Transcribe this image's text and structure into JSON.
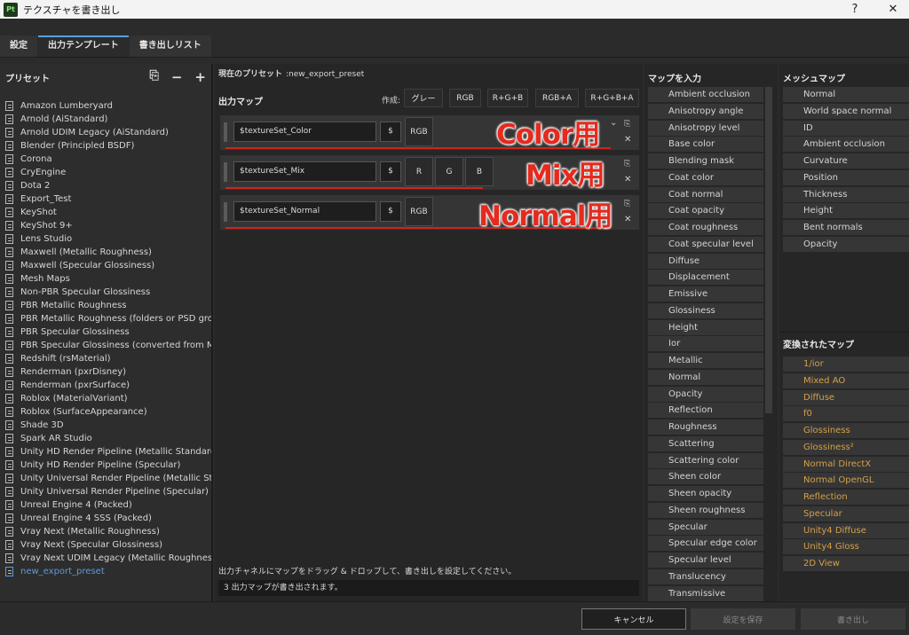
{
  "window": {
    "logo": "Pt",
    "title": "テクスチャを書き出し",
    "help": "?",
    "close": "✕"
  },
  "tabs": [
    "設定",
    "出力テンプレート",
    "書き出しリスト"
  ],
  "presets": {
    "title": "プリセット",
    "items": [
      "Amazon Lumberyard",
      "Arnold (AiStandard)",
      "Arnold UDIM Legacy (AiStandard)",
      "Blender (Principled BSDF)",
      "Corona",
      "CryEngine",
      "Dota 2",
      "Export_Test",
      "KeyShot",
      "KeyShot 9+",
      "Lens Studio",
      "Maxwell (Metallic Roughness)",
      "Maxwell (Specular Glossiness)",
      "Mesh Maps",
      "Non-PBR Specular Glossiness",
      "PBR Metallic Roughness",
      "PBR Metallic Roughness (folders or PSD gro...",
      "PBR Specular Glossiness",
      "PBR Specular Glossiness (converted from M...",
      "Redshift (rsMaterial)",
      "Renderman (pxrDisney)",
      "Renderman (pxrSurface)",
      "Roblox (MaterialVariant)",
      "Roblox (SurfaceAppearance)",
      "Shade 3D",
      "Spark AR Studio",
      "Unity HD Render Pipeline (Metallic Standard)",
      "Unity HD Render Pipeline (Specular)",
      "Unity Universal Render Pipeline (Metallic St...",
      "Unity Universal Render Pipeline (Specular)",
      "Unreal Engine 4 (Packed)",
      "Unreal Engine 4 SSS (Packed)",
      "Vray Next (Metallic Roughness)",
      "Vray Next (Specular Glossiness)",
      "Vray Next UDIM Legacy (Metallic Roughness)",
      "new_export_preset"
    ],
    "selected_index": 35
  },
  "current_preset": {
    "label": "現在のプリセット",
    "value": ":new_export_preset"
  },
  "output_maps": {
    "title": "出力マップ",
    "create_label": "作成:",
    "create_buttons": [
      "グレー",
      "RGB",
      "R+G+B",
      "RGB+A",
      "R+G+B+A"
    ],
    "rows": [
      {
        "name": "$textureSet_Color",
        "dollar": "$",
        "channels": [
          "RGB"
        ],
        "annotation": "Color用"
      },
      {
        "name": "$textureSet_Mix",
        "dollar": "$",
        "channels": [
          "R",
          "G",
          "B"
        ],
        "annotation": "Mix用"
      },
      {
        "name": "$textureSet_Normal",
        "dollar": "$",
        "channels": [
          "RGB"
        ],
        "annotation": "Normal用"
      }
    ],
    "hint": "出力チャネルにマップをドラッグ & ドロップして、書き出しを設定してください。",
    "status": "3 出力マップが書き出されます。"
  },
  "input_maps": {
    "title": "マップを入力",
    "items": [
      "Ambient occlusion",
      "Anisotropy angle",
      "Anisotropy level",
      "Base color",
      "Blending mask",
      "Coat color",
      "Coat normal",
      "Coat opacity",
      "Coat roughness",
      "Coat specular level",
      "Diffuse",
      "Displacement",
      "Emissive",
      "Glossiness",
      "Height",
      "Ior",
      "Metallic",
      "Normal",
      "Opacity",
      "Reflection",
      "Roughness",
      "Scattering",
      "Scattering color",
      "Sheen color",
      "Sheen opacity",
      "Sheen roughness",
      "Specular",
      "Specular edge color",
      "Specular level",
      "Translucency",
      "Transmissive"
    ]
  },
  "mesh_maps": {
    "title": "メッシュマップ",
    "items": [
      "Normal",
      "World space normal",
      "ID",
      "Ambient occlusion",
      "Curvature",
      "Position",
      "Thickness",
      "Height",
      "Bent normals",
      "Opacity"
    ]
  },
  "converted_maps": {
    "title": "変換されたマップ",
    "items": [
      "1/ior",
      "Mixed AO",
      "Diffuse",
      "f0",
      "Glossiness",
      "Glossiness²",
      "Normal DirectX",
      "Normal OpenGL",
      "Reflection",
      "Specular",
      "Unity4 Diffuse",
      "Unity4 Gloss",
      "2D View"
    ]
  },
  "footer": {
    "cancel": "キャンセル",
    "save": "設定を保存",
    "export": "書き出し"
  },
  "colors": {
    "accent": "#5aa0d8",
    "annotation_red": "#e52a1e",
    "converted_text": "#d4a04a"
  }
}
